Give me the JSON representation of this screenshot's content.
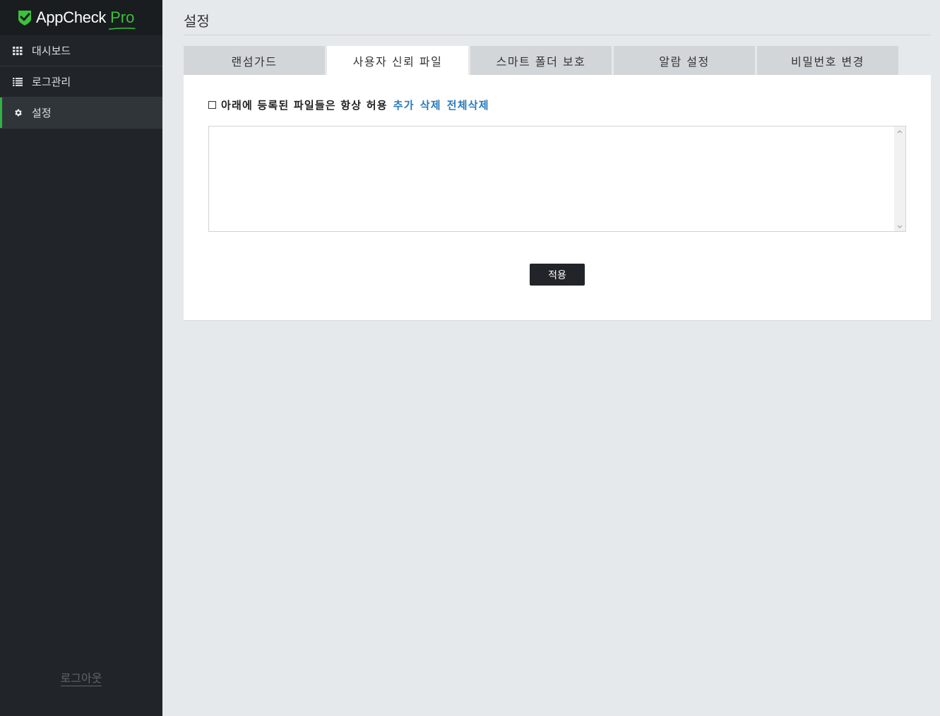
{
  "app": {
    "logo_text": "AppCheck",
    "logo_pro": "Pro",
    "brand_color": "#3cc13b"
  },
  "sidebar": {
    "items": [
      {
        "label": "대시보드",
        "icon": "grid-icon",
        "active": false
      },
      {
        "label": "로그관리",
        "icon": "list-icon",
        "active": false
      },
      {
        "label": "설정",
        "icon": "gear-icon",
        "active": true
      }
    ],
    "logout_label": "로그아웃"
  },
  "page": {
    "title": "설정"
  },
  "tabs": [
    {
      "label": "랜섬가드",
      "active": false
    },
    {
      "label": "사용자 신뢰 파일",
      "active": true
    },
    {
      "label": "스마트 폴더 보호",
      "active": false
    },
    {
      "label": "알람 설정",
      "active": false
    },
    {
      "label": "비밀번호 변경",
      "active": false
    }
  ],
  "trusted_files": {
    "checkbox_label": "아래에 등록된 파일들은 항상 허용",
    "checked": false,
    "add_label": "추가",
    "delete_label": "삭제",
    "delete_all_label": "전체삭제",
    "files": []
  },
  "apply_label": "적용"
}
